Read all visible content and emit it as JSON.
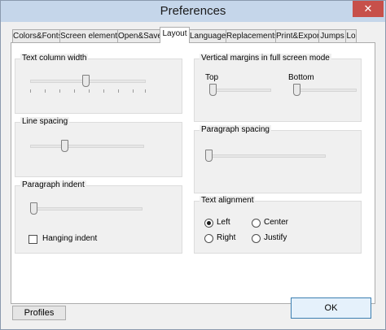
{
  "window": {
    "title": "Preferences",
    "close_glyph": "✕"
  },
  "tabs": [
    {
      "label": "Colors&Fonts",
      "active": false
    },
    {
      "label": "Screen elements",
      "active": false
    },
    {
      "label": "Open&Save",
      "active": false
    },
    {
      "label": "Layout",
      "active": true
    },
    {
      "label": "Language",
      "active": false
    },
    {
      "label": "Replacements",
      "active": false
    },
    {
      "label": "Print&Export",
      "active": false
    },
    {
      "label": "Jumps",
      "active": false
    },
    {
      "label": "Lo",
      "active": false
    }
  ],
  "layout": {
    "text_column_width": {
      "label": "Text column width",
      "value": 0.48
    },
    "line_spacing": {
      "label": "Line spacing",
      "value": 0.29
    },
    "paragraph_indent": {
      "label": "Paragraph indent",
      "value": 0.0,
      "hanging_indent_label": "Hanging indent",
      "hanging_indent_checked": false
    },
    "vertical_margins": {
      "label": "Vertical margins in full screen mode",
      "top_label": "Top",
      "top_value": 0.0,
      "bottom_label": "Bottom",
      "bottom_value": 0.0
    },
    "paragraph_spacing": {
      "label": "Paragraph spacing",
      "value": 0.0
    },
    "text_alignment": {
      "label": "Text alignment",
      "options": [
        "Left",
        "Center",
        "Right",
        "Justify"
      ],
      "selected": "Left"
    }
  },
  "buttons": {
    "profiles": "Profiles",
    "ok": "OK"
  }
}
